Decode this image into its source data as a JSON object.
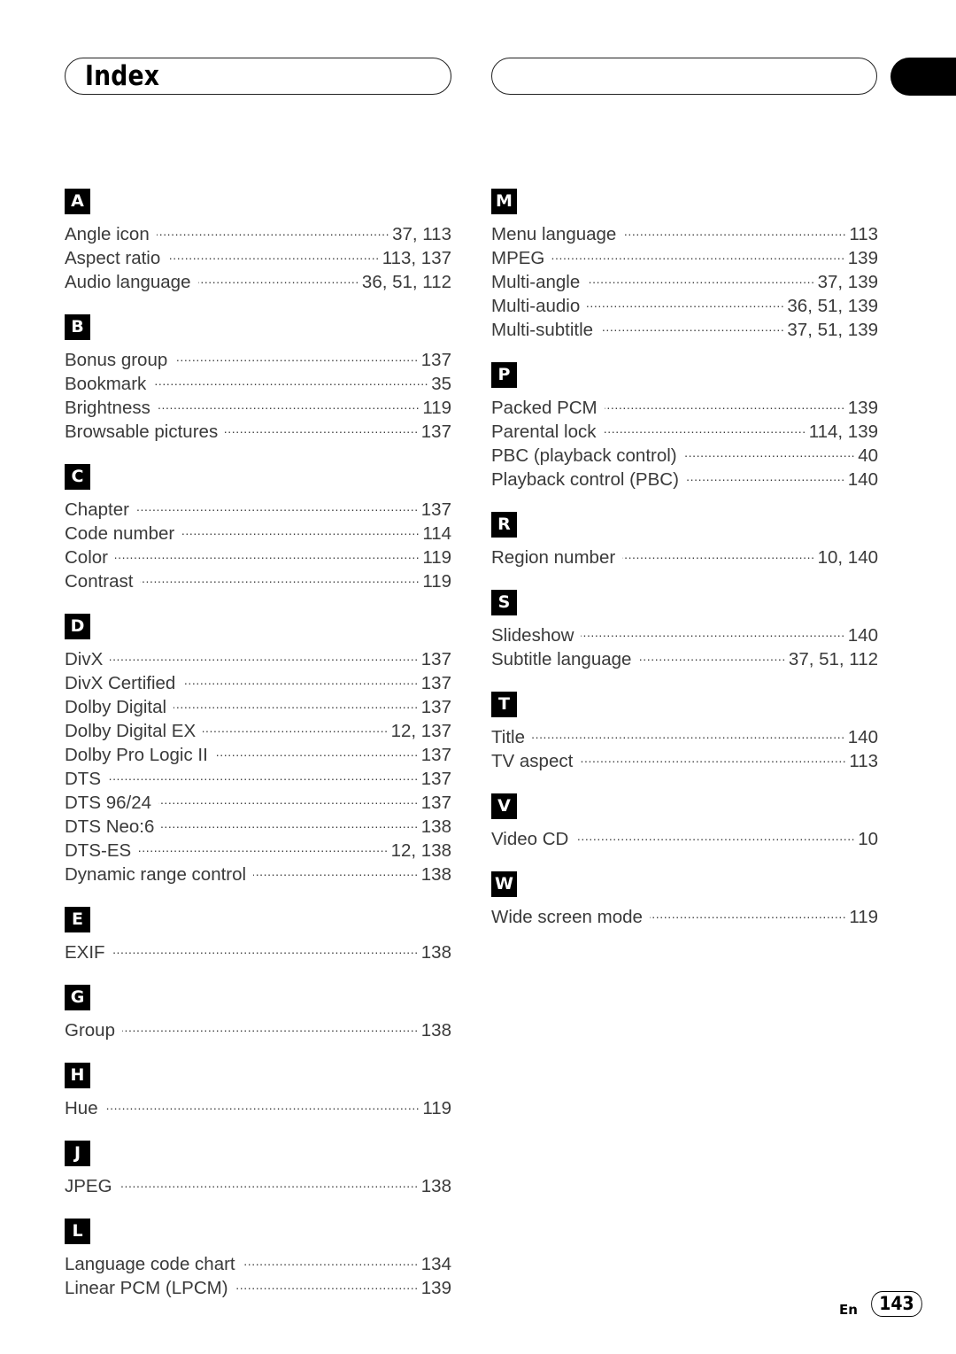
{
  "header": {
    "title": "Index"
  },
  "columns": [
    {
      "sections": [
        {
          "letter": "A",
          "entries": [
            {
              "term": "Angle icon",
              "pages": "37, 113"
            },
            {
              "term": "Aspect ratio",
              "pages": "113, 137"
            },
            {
              "term": "Audio language",
              "pages": "36, 51, 112"
            }
          ]
        },
        {
          "letter": "B",
          "entries": [
            {
              "term": "Bonus group",
              "pages": "137"
            },
            {
              "term": "Bookmark",
              "pages": "35"
            },
            {
              "term": "Brightness",
              "pages": "119"
            },
            {
              "term": "Browsable pictures",
              "pages": "137"
            }
          ]
        },
        {
          "letter": "C",
          "entries": [
            {
              "term": "Chapter",
              "pages": "137"
            },
            {
              "term": "Code number",
              "pages": "114"
            },
            {
              "term": "Color",
              "pages": "119"
            },
            {
              "term": "Contrast",
              "pages": "119"
            }
          ]
        },
        {
          "letter": "D",
          "entries": [
            {
              "term": "DivX",
              "pages": "137"
            },
            {
              "term": "DivX Certified",
              "pages": "137"
            },
            {
              "term": "Dolby Digital",
              "pages": "137"
            },
            {
              "term": "Dolby Digital EX",
              "pages": "12, 137"
            },
            {
              "term": "Dolby Pro Logic II",
              "pages": "137"
            },
            {
              "term": "DTS",
              "pages": "137"
            },
            {
              "term": "DTS 96/24",
              "pages": "137"
            },
            {
              "term": "DTS Neo:6",
              "pages": "138"
            },
            {
              "term": "DTS-ES",
              "pages": "12, 138"
            },
            {
              "term": "Dynamic range control",
              "pages": "138"
            }
          ]
        },
        {
          "letter": "E",
          "entries": [
            {
              "term": "EXIF",
              "pages": "138"
            }
          ]
        },
        {
          "letter": "G",
          "entries": [
            {
              "term": "Group",
              "pages": "138"
            }
          ]
        },
        {
          "letter": "H",
          "entries": [
            {
              "term": "Hue",
              "pages": "119"
            }
          ]
        },
        {
          "letter": "J",
          "entries": [
            {
              "term": "JPEG",
              "pages": "138"
            }
          ]
        },
        {
          "letter": "L",
          "entries": [
            {
              "term": "Language code chart",
              "pages": "134"
            },
            {
              "term": "Linear PCM (LPCM)",
              "pages": "139"
            }
          ]
        }
      ]
    },
    {
      "sections": [
        {
          "letter": "M",
          "entries": [
            {
              "term": "Menu language",
              "pages": "113"
            },
            {
              "term": "MPEG",
              "pages": "139"
            },
            {
              "term": "Multi-angle",
              "pages": "37, 139"
            },
            {
              "term": "Multi-audio",
              "pages": "36, 51, 139"
            },
            {
              "term": "Multi-subtitle",
              "pages": "37, 51, 139"
            }
          ]
        },
        {
          "letter": "P",
          "entries": [
            {
              "term": "Packed PCM",
              "pages": "139"
            },
            {
              "term": "Parental lock",
              "pages": "114, 139"
            },
            {
              "term": "PBC (playback control)",
              "pages": "40"
            },
            {
              "term": "Playback control (PBC)",
              "pages": "140"
            }
          ]
        },
        {
          "letter": "R",
          "entries": [
            {
              "term": "Region number",
              "pages": "10, 140"
            }
          ]
        },
        {
          "letter": "S",
          "entries": [
            {
              "term": "Slideshow",
              "pages": "140"
            },
            {
              "term": "Subtitle language",
              "pages": "37, 51, 112"
            }
          ]
        },
        {
          "letter": "T",
          "entries": [
            {
              "term": "Title",
              "pages": "140"
            },
            {
              "term": "TV aspect",
              "pages": "113"
            }
          ]
        },
        {
          "letter": "V",
          "entries": [
            {
              "term": "Video CD",
              "pages": "10"
            }
          ]
        },
        {
          "letter": "W",
          "entries": [
            {
              "term": "Wide screen mode",
              "pages": "119"
            }
          ]
        }
      ]
    }
  ],
  "footer": {
    "language": "En",
    "page_number": "143"
  }
}
